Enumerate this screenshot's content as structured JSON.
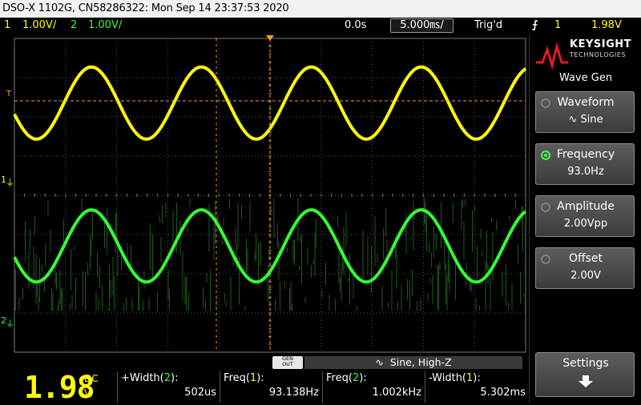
{
  "title_bar": {
    "text": "DSO-X 1102G, CN58286322: Mon Sep 14 23:37:53 2020"
  },
  "status_bar": {
    "ch1_number": "1",
    "ch1_scale": "1.00V/",
    "ch2_number": "2",
    "ch2_scale": "1.00V/",
    "delay": "0.0s",
    "timebase": "5.000㎳/",
    "trigger_state": "Trig'd",
    "trigger_source": "1",
    "trigger_level": "1.98V"
  },
  "colors": {
    "ch1": "#ffff00",
    "ch2": "#33ff33",
    "trigger_marker": "#ff9933"
  },
  "display": {
    "ch1_marker": "1",
    "ch2_marker": "2",
    "trigger_marker": "T"
  },
  "logo": {
    "brand": "KEYSIGHT",
    "sub": "TECHNOLOGIES"
  },
  "menu": {
    "title": "Wave Gen",
    "softkeys": [
      {
        "label": "Waveform",
        "value": "Sine"
      },
      {
        "label": "Frequency",
        "value": "93.0Hz"
      },
      {
        "label": "Amplitude",
        "value": "2.00Vpp"
      },
      {
        "label": "Offset",
        "value": "2.00V"
      },
      {
        "label": "Settings",
        "value": ""
      }
    ]
  },
  "gen_out": {
    "label_line1": "GEN",
    "label_line2": "OUT",
    "status": "Sine, High-Z"
  },
  "measurement": {
    "big_value": "1.98",
    "big_dc": "DC",
    "big_unit": "V",
    "items": [
      {
        "label_prefix": "+Width(",
        "channel": "2",
        "label_suffix": "):",
        "value": "502us"
      },
      {
        "label_prefix": "Freq(",
        "channel": "1",
        "label_suffix": "):",
        "value": "93.138Hz"
      },
      {
        "label_prefix": "Freq(",
        "channel": "2",
        "label_suffix": "):",
        "value": "1.002kHz"
      },
      {
        "label_prefix": "-Width(",
        "channel": "1",
        "label_suffix": "):",
        "value": "5.302ms"
      }
    ]
  },
  "waveforms": {
    "ch1": {
      "type": "sine",
      "cycles_on_screen": 4.65,
      "amplitude_divisions": 1.0
    },
    "ch2": {
      "type": "sine with noise",
      "cycles_on_screen": 4.65,
      "amplitude_divisions": 1.0
    }
  }
}
